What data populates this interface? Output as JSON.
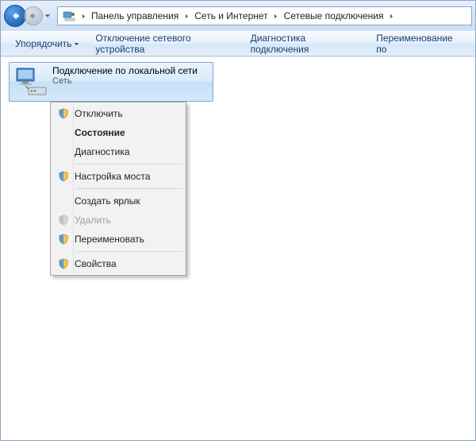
{
  "breadcrumb": {
    "segments": [
      "Панель управления",
      "Сеть и Интернет",
      "Сетевые подключения"
    ]
  },
  "toolbar": {
    "organize": "Упорядочить",
    "disable_device": "Отключение сетевого устройства",
    "diagnose": "Диагностика подключения",
    "rename": "Переименование по"
  },
  "connection": {
    "title": "Подключение по локальной сети",
    "subtitle": "Сеть"
  },
  "context_menu": {
    "disable": "Отключить",
    "status": "Состояние",
    "diagnose": "Диагностика",
    "bridge": "Настройка моста",
    "shortcut": "Создать ярлык",
    "delete": "Удалить",
    "rename": "Переименовать",
    "properties": "Свойства"
  }
}
